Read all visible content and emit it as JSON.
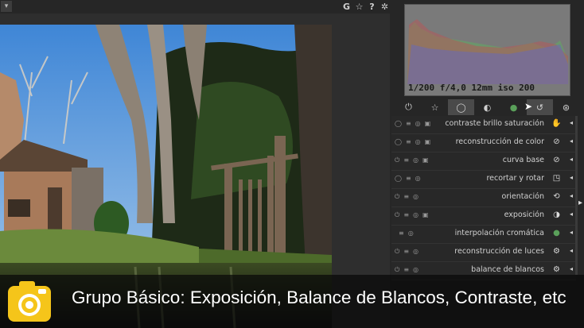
{
  "toolbar": {
    "collapse_icon": "▾",
    "icons": [
      {
        "name": "g-icon",
        "glyph": "G"
      },
      {
        "name": "star-icon",
        "glyph": "☆"
      },
      {
        "name": "help-icon",
        "glyph": "?"
      },
      {
        "name": "gear-icon",
        "glyph": "✲"
      }
    ]
  },
  "histogram": {
    "exif": "1/200 f/4,0 12mm iso 200"
  },
  "module_tabs": [
    {
      "name": "tab-active-modules-icon",
      "glyph": "⏻"
    },
    {
      "name": "tab-favorites-icon",
      "glyph": "☆"
    },
    {
      "name": "tab-basic-group-icon",
      "glyph": "◯",
      "active": true
    },
    {
      "name": "tab-tone-group-icon",
      "glyph": "◐"
    },
    {
      "name": "tab-color-group-icon",
      "glyph": "●"
    },
    {
      "name": "tab-correct-group-icon",
      "glyph": "↺"
    },
    {
      "name": "tab-effects-group-icon",
      "glyph": "⊛"
    }
  ],
  "modules": [
    {
      "label": "contraste brillo saturación",
      "icon": "✋",
      "ctl": [
        "◯",
        "≡",
        "◎",
        "▣"
      ]
    },
    {
      "label": "reconstrucción de color",
      "icon": "⊘",
      "ctl": [
        "◯",
        "≡",
        "◎",
        "▣"
      ]
    },
    {
      "label": "curva base",
      "icon": "⊘",
      "ctl": [
        "⏻",
        "≡",
        "◎",
        "▣"
      ]
    },
    {
      "label": "recortar y rotar",
      "icon": "◳",
      "ctl": [
        "◯",
        "≡",
        "◎",
        ""
      ]
    },
    {
      "label": "orientación",
      "icon": "⟲",
      "ctl": [
        "⏻",
        "≡",
        "◎",
        ""
      ]
    },
    {
      "label": "exposición",
      "icon": "◑",
      "ctl": [
        "⏻",
        "≡",
        "◎",
        "▣"
      ]
    },
    {
      "label": "interpolación cromática",
      "icon": "●",
      "ctl": [
        "",
        "≡",
        "◎",
        ""
      ]
    },
    {
      "label": "reconstrucción de luces",
      "icon": "⚙",
      "ctl": [
        "⏻",
        "≡",
        "◎",
        ""
      ]
    },
    {
      "label": "balance de blancos",
      "icon": "⚙",
      "ctl": [
        "⏻",
        "≡",
        "◎",
        ""
      ]
    }
  ],
  "expand_arrow": "◂",
  "side_arrow": "▸",
  "caption": "Grupo Básico: Exposición, Balance de Blancos, Contraste, etc",
  "colors": {
    "accent_yellow": "#f5c51a",
    "panel_bg": "#262626"
  }
}
